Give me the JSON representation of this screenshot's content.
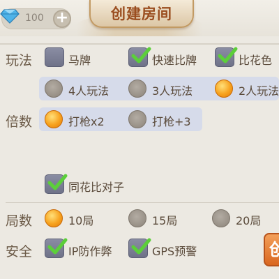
{
  "header": {
    "gem_count": "100",
    "title": "创建房间"
  },
  "rows": {
    "wanfa": {
      "label": "玩法",
      "options": [
        {
          "label": "马牌",
          "checked": false
        },
        {
          "label": "快速比牌",
          "checked": true
        },
        {
          "label": "比花色",
          "checked": true
        }
      ],
      "players": [
        {
          "label": "4人玩法",
          "selected": false
        },
        {
          "label": "3人玩法",
          "selected": false
        },
        {
          "label": "2人玩法",
          "selected": true
        }
      ]
    },
    "beishu": {
      "label": "倍数",
      "options": [
        {
          "label": "打枪x2",
          "selected": true
        },
        {
          "label": "打枪+3",
          "selected": false
        }
      ],
      "extra": {
        "label": "同花比对子",
        "checked": true
      }
    },
    "jushu": {
      "label": "局数",
      "options": [
        {
          "label": "10局",
          "selected": true
        },
        {
          "label": "15局",
          "selected": false
        },
        {
          "label": "20局",
          "selected": false
        }
      ]
    },
    "anquan": {
      "label": "安全",
      "options": [
        {
          "label": "IP防作弊",
          "checked": true
        },
        {
          "label": "GPS预警",
          "checked": true
        }
      ]
    }
  },
  "create_button": {
    "label": "创"
  },
  "colors": {
    "background": "#ece9e2",
    "band": "#d6dbea",
    "radio_on": "#f7a21e",
    "check": "#5ccf3a",
    "title": "#9a4d1f"
  }
}
